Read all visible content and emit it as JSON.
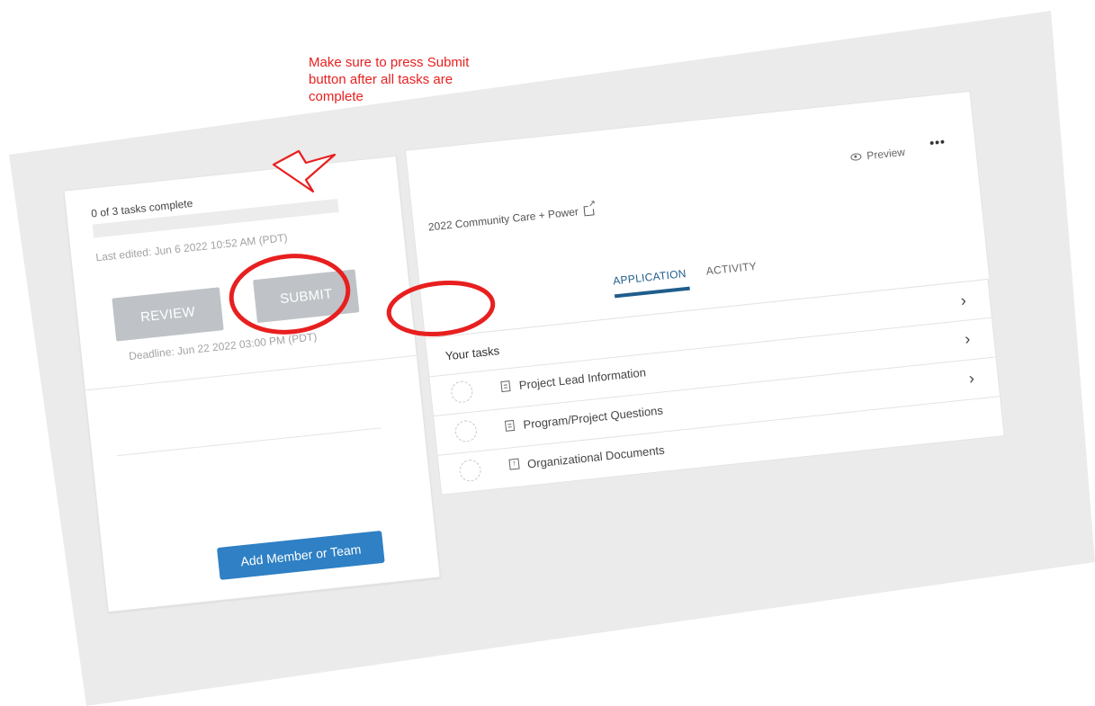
{
  "annotation": {
    "note": "Make sure to press Submit button after all tasks are complete"
  },
  "status_panel": {
    "tasks_complete": "0 of 3 tasks complete",
    "progress_fraction": 0,
    "last_edited": "Last edited: Jun 6 2022 10:52 AM (PDT)",
    "review_label": "REVIEW",
    "submit_label": "SUBMIT",
    "deadline": "Deadline: Jun 22 2022 03:00 PM (PDT)",
    "add_member_label": "Add Member or Team"
  },
  "header": {
    "preview_label": "Preview",
    "more_label": "•••",
    "program_title": "2022 Community Care + Power"
  },
  "tabs": [
    {
      "label": "APPLICATION",
      "active": true
    },
    {
      "label": "ACTIVITY",
      "active": false
    }
  ],
  "tasks": {
    "heading": "Your tasks",
    "items": [
      {
        "label": "Project Lead Information",
        "icon": "document-icon"
      },
      {
        "label": "Program/Project Questions",
        "icon": "document-icon"
      },
      {
        "label": "Organizational Documents",
        "icon": "upload-icon"
      }
    ]
  },
  "colors": {
    "annotation": "#e81f1f",
    "primary": "#2f80c4",
    "active_tab": "#1f5d8c",
    "disabled_button": "#bfc3c7",
    "backdrop": "#ebebeb"
  }
}
